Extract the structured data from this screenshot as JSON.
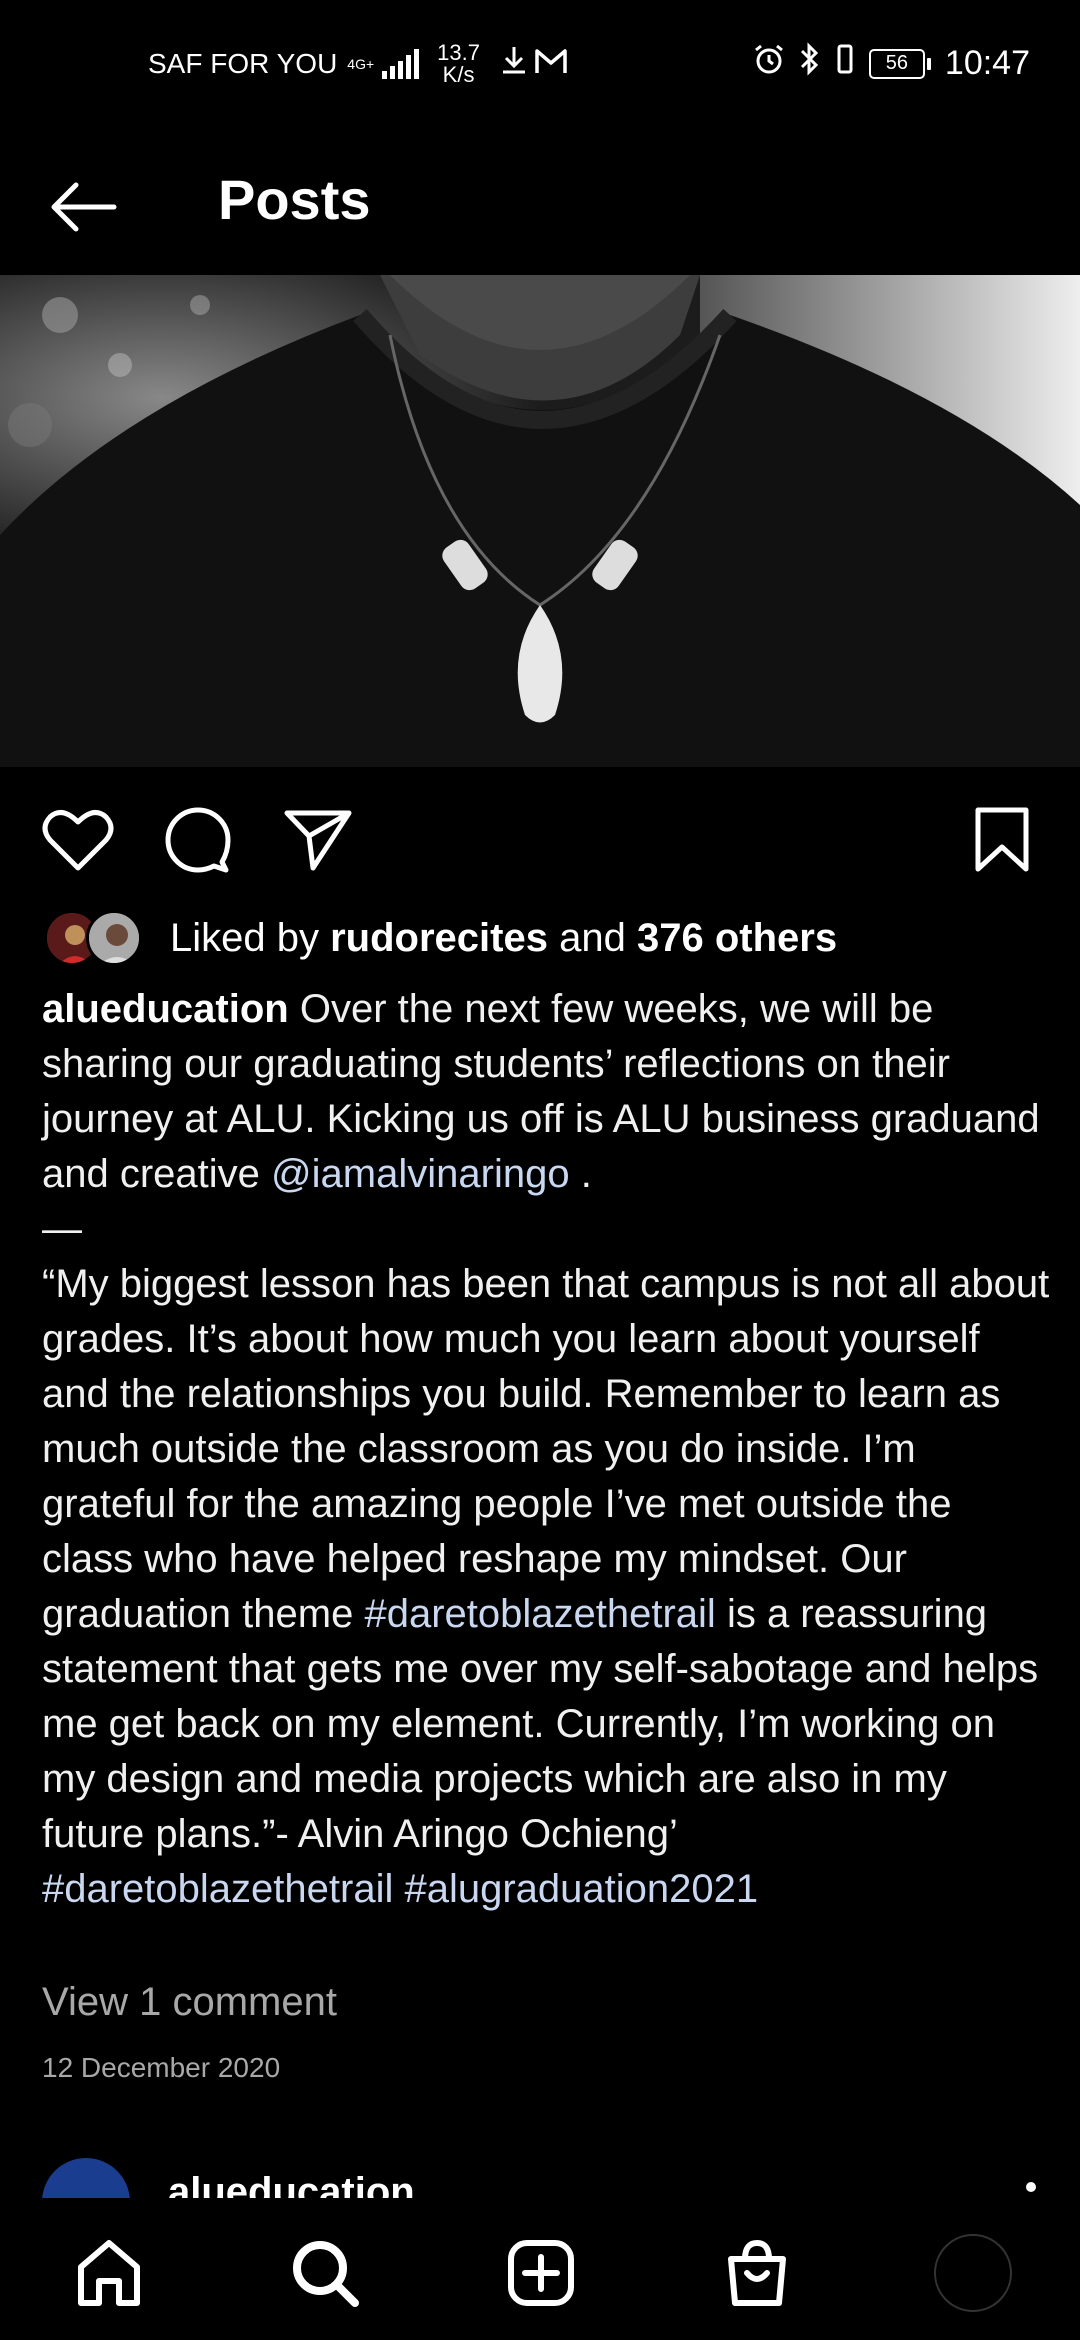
{
  "status_bar": {
    "carrier": "SAF FOR YOU",
    "network": "4G+",
    "speed_value": "13.7",
    "speed_unit": "K/s",
    "battery": "56",
    "time": "10:47",
    "icons": [
      "download-icon",
      "gmail-icon",
      "alarm-icon",
      "bluetooth-icon",
      "vibrate-icon",
      "battery-icon"
    ]
  },
  "header": {
    "title": "Posts",
    "back_icon": "back-arrow-icon"
  },
  "post": {
    "likes": {
      "prefix": "Liked by",
      "user": "rudorecites",
      "conjunction": "and",
      "others": "376 others"
    },
    "caption": {
      "username": "alueducation",
      "intro": "Over the next few weeks, we will be sharing our graduating students’ reflections on their journey at ALU. Kicking us off is ALU business graduand and creative",
      "mention": "@iamalvinaringo",
      "intro_end": ".",
      "separator": "—",
      "quote_part1": "“My biggest lesson has been that campus is not all about grades. It’s about how much you learn about yourself and the relationships you build. Remember to learn as much outside the classroom as you do inside. I’m grateful for the amazing people I’ve met outside the class who have helped reshape my mindset. Our graduation theme",
      "quote_hashtag": "#daretoblazethetrail",
      "quote_part2": "is a reassuring statement that gets me over my self-sabotage and helps me get back on my element. Currently, I’m working on my design and media projects which are also in my future plans.”- Alvin Aringo Ochieng’",
      "hashtags": [
        "#daretoblazethetrail",
        "#alugraduation2021"
      ]
    },
    "view_comments": "View 1 comment",
    "date": "12 December 2020"
  },
  "next_post": {
    "username": "alueducation"
  },
  "bottom_nav": {
    "items": [
      "home-icon",
      "search-icon",
      "new-post-icon",
      "shop-icon",
      "profile-avatar"
    ]
  }
}
